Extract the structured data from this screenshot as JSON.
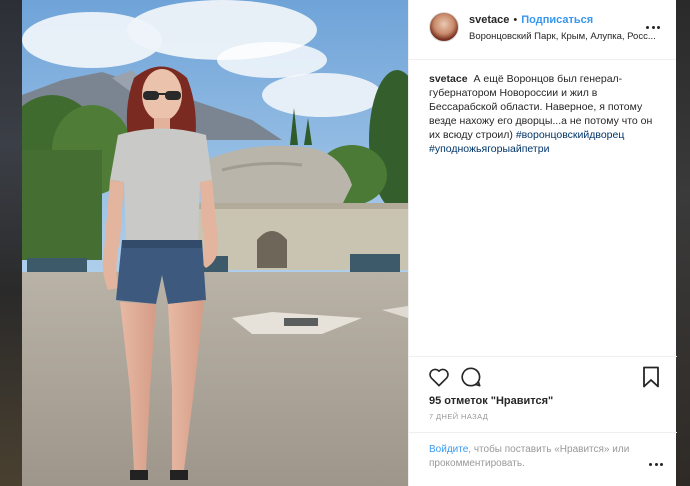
{
  "post": {
    "username": "svetace",
    "dot": "•",
    "follow_label": "Подписаться",
    "location": "Воронцовский Парк, Крым, Алупка, Росс...",
    "caption_text": "А ещё Воронцов был генерал-губернатором Новороссии и жил в Бессарабской области. Наверное, я потому везде нахожу его дворцы...а не потому что он их всюду строил)",
    "hashtags": [
      "#воронцовскийдворец",
      "#уподножьягорыайпетри"
    ],
    "likes": "95 отметок \"Нравится\"",
    "date": "7 ДНЕЙ НАЗАД",
    "login_link": "Войдите",
    "login_rest": ", чтобы поставить «Нравится» или прокомментировать."
  },
  "icons": {
    "like": "heart-icon",
    "comment": "comment-icon",
    "save": "bookmark-icon",
    "more": "more-options-icon"
  },
  "colors": {
    "accent": "#3897f0",
    "hashtag": "#003569",
    "text": "#262626",
    "muted": "#999999"
  }
}
